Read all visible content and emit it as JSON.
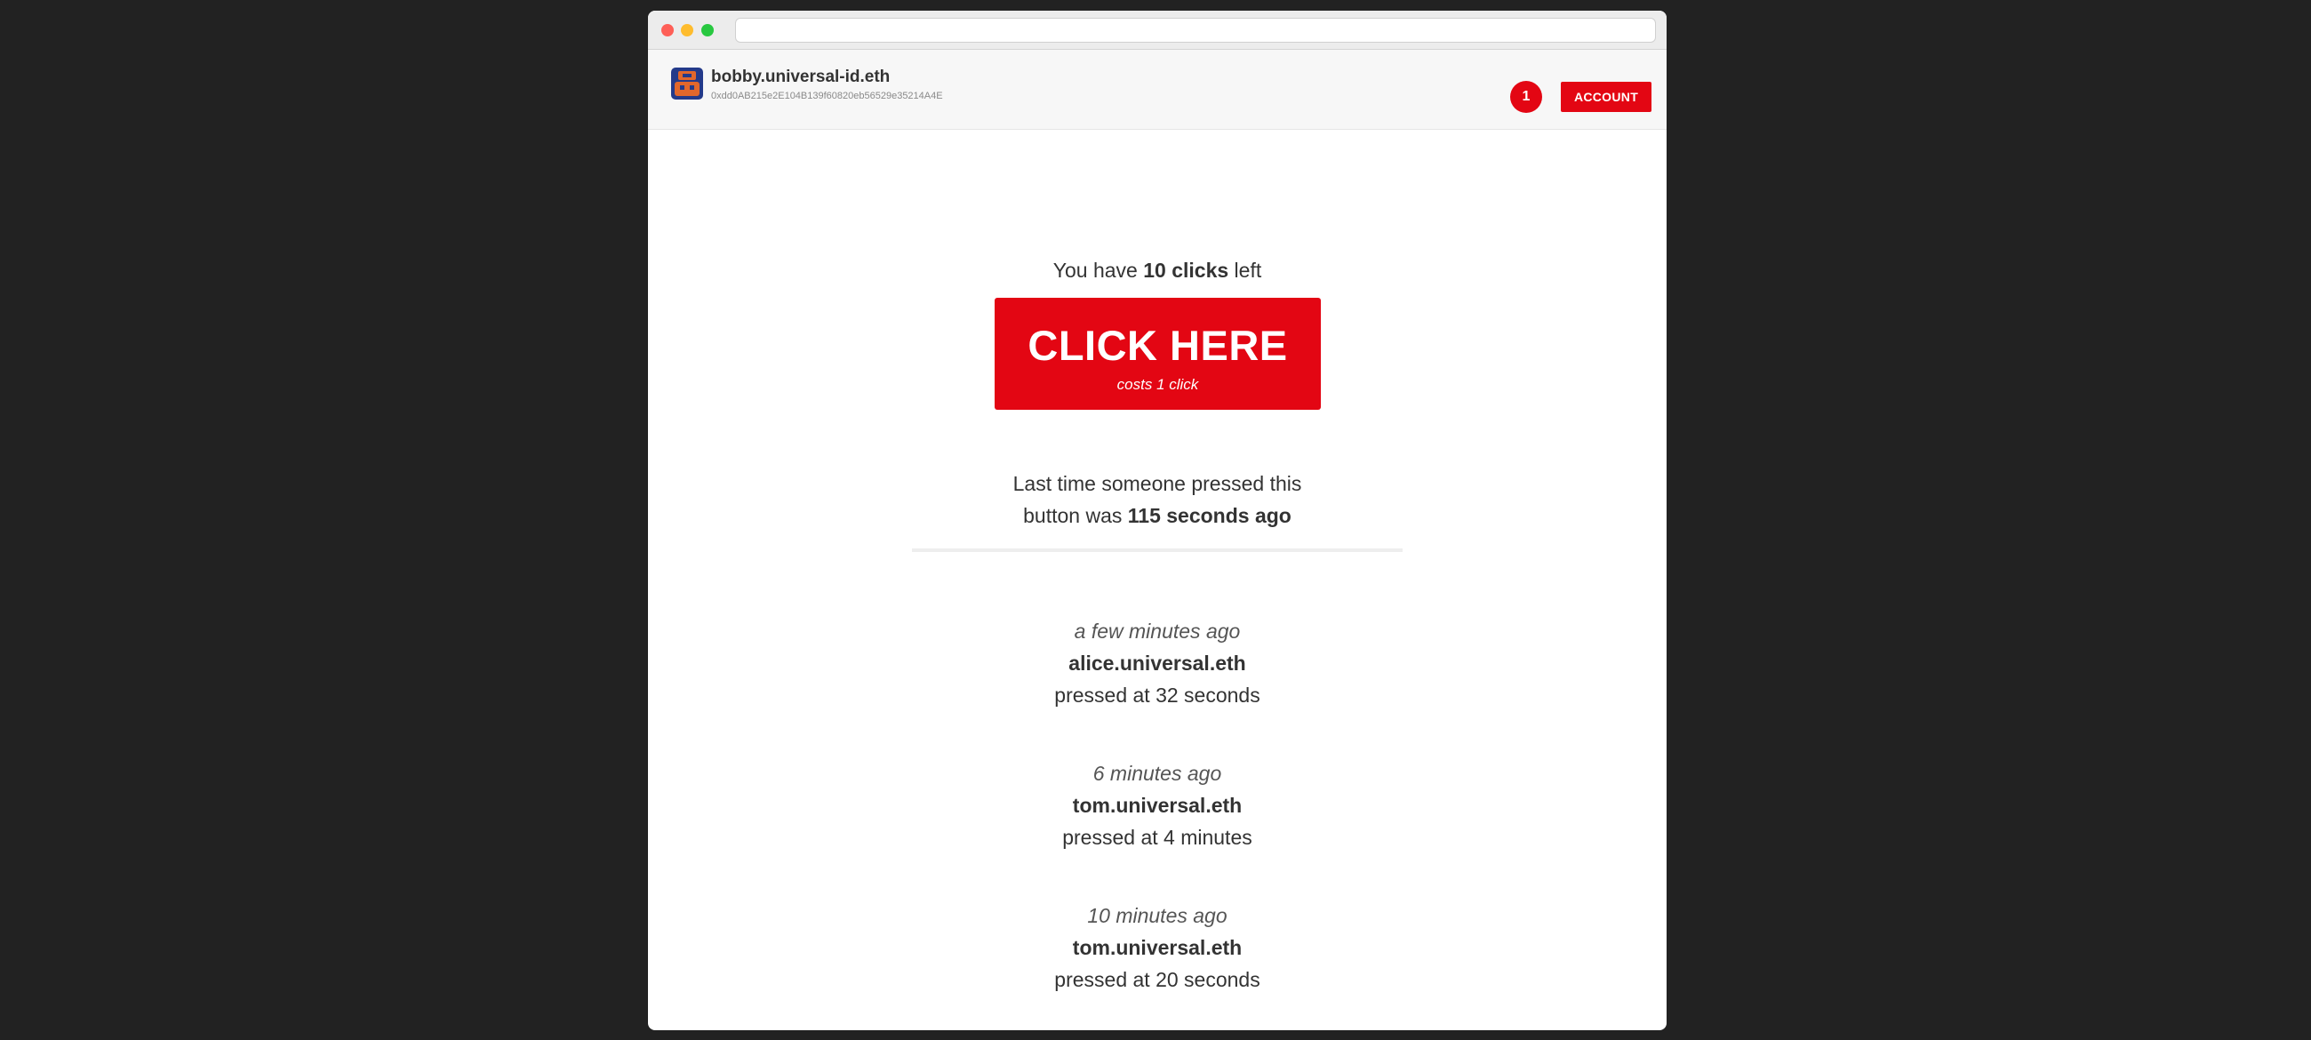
{
  "browser": {
    "url": ""
  },
  "header": {
    "ens_name": "bobby.universal-id.eth",
    "address": "0xdd0AB215e2E104B139f60820eb56529e35214A4E",
    "notification_count": "1",
    "account_label": "ACCOUNT"
  },
  "main": {
    "clicks_prefix": "You have ",
    "clicks_count": "10 clicks",
    "clicks_suffix": " left",
    "button_label": "CLICK HERE",
    "button_cost": "costs 1 click",
    "last_press_line1": "Last time someone pressed this",
    "last_press_line2_prefix": "button was ",
    "last_press_value": "115 seconds ago"
  },
  "history": [
    {
      "when": "a few minutes ago",
      "who": "alice.universal.eth",
      "detail": "pressed at 32 seconds"
    },
    {
      "when": "6 minutes ago",
      "who": "tom.universal.eth",
      "detail": "pressed at 4 minutes"
    },
    {
      "when": "10 minutes ago",
      "who": "tom.universal.eth",
      "detail": "pressed at 20 seconds"
    }
  ],
  "colors": {
    "accent": "#e30613",
    "background": "#222222"
  }
}
